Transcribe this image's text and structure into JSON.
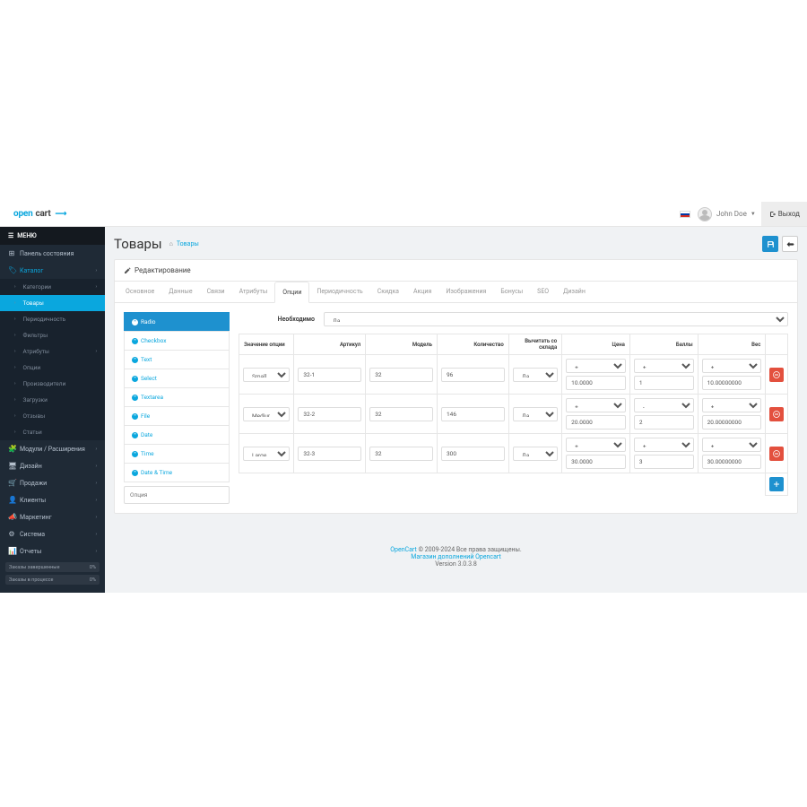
{
  "brand": {
    "open": "open",
    "cart": "cart"
  },
  "user": {
    "name": "John Doe",
    "logout": "Выход"
  },
  "menu": {
    "header": "МЕНЮ",
    "items": [
      {
        "icon": "⊞",
        "label": "Панель состояния"
      },
      {
        "icon": "🏷",
        "label": "Каталог",
        "active": true,
        "expanded": true
      },
      {
        "icon": "🧩",
        "label": "Модули / Расширения",
        "expand": true
      },
      {
        "icon": "🖥",
        "label": "Дизайн",
        "expand": true
      },
      {
        "icon": "🛒",
        "label": "Продажи",
        "expand": true
      },
      {
        "icon": "👤",
        "label": "Клиенты",
        "expand": true
      },
      {
        "icon": "📣",
        "label": "Маркетинг",
        "expand": true
      },
      {
        "icon": "⚙",
        "label": "Система",
        "expand": true
      },
      {
        "icon": "📊",
        "label": "Отчеты",
        "expand": true
      }
    ],
    "catalog_sub": [
      {
        "label": "Категории",
        "expand": true
      },
      {
        "label": "Товары",
        "sel": true
      },
      {
        "label": "Периодичность"
      },
      {
        "label": "Фильтры"
      },
      {
        "label": "Атрибуты",
        "expand": true
      },
      {
        "label": "Опции"
      },
      {
        "label": "Производители"
      },
      {
        "label": "Загрузки"
      },
      {
        "label": "Отзывы"
      },
      {
        "label": "Статьи"
      }
    ],
    "stats": [
      {
        "label": "Заказы завершенные",
        "pct": "0%"
      },
      {
        "label": "Заказы в процессе",
        "pct": "0%"
      }
    ]
  },
  "page": {
    "title": "Товары",
    "home": "⌂",
    "crumb": "Товары",
    "panel_title": "Редактирование"
  },
  "tabs": [
    "Основное",
    "Данные",
    "Связи",
    "Атрибуты",
    "Опции",
    "Периодичность",
    "Скидка",
    "Акция",
    "Изображения",
    "Бонусы",
    "SEO",
    "Дизайн"
  ],
  "active_tab": "Опции",
  "option_tabs": [
    "Radio",
    "Checkbox",
    "Text",
    "Select",
    "Textarea",
    "File",
    "Date",
    "Time",
    "Date & Time"
  ],
  "active_option_tab": "Radio",
  "option_input_placeholder": "Опция",
  "form": {
    "required_label": "Необходимо",
    "required_value": "Да"
  },
  "table": {
    "headers": {
      "value": "Значение опции",
      "article": "Артикул",
      "model": "Модель",
      "qty": "Количество",
      "subtract": "Вычитать со склада",
      "price": "Цена",
      "points": "Баллы",
      "weight": "Вес"
    },
    "rows": [
      {
        "value": "Small",
        "article": "32-1",
        "model": "32",
        "qty": "96",
        "subtract": "Да",
        "price_op": "+",
        "price": "10.0000",
        "points_op": "+",
        "points": "1",
        "weight_op": "+",
        "weight": "10.00000000"
      },
      {
        "value": "Medium",
        "article": "32-2",
        "model": "32",
        "qty": "146",
        "subtract": "Да",
        "price_op": "+",
        "price": "20.0000",
        "points_op": "-",
        "points": "2",
        "weight_op": "+",
        "weight": "20.00000000"
      },
      {
        "value": "Large",
        "article": "32-3",
        "model": "32",
        "qty": "300",
        "subtract": "Да",
        "price_op": "+",
        "price": "30.0000",
        "points_op": "+",
        "points": "3",
        "weight_op": "+",
        "weight": "30.00000000"
      }
    ]
  },
  "footer": {
    "brand": "OpenCart",
    "copy": " © 2009-2024 Все права защищены.",
    "store": "Магазин дополнений Opencart",
    "version": "Version 3.0.3.8"
  }
}
